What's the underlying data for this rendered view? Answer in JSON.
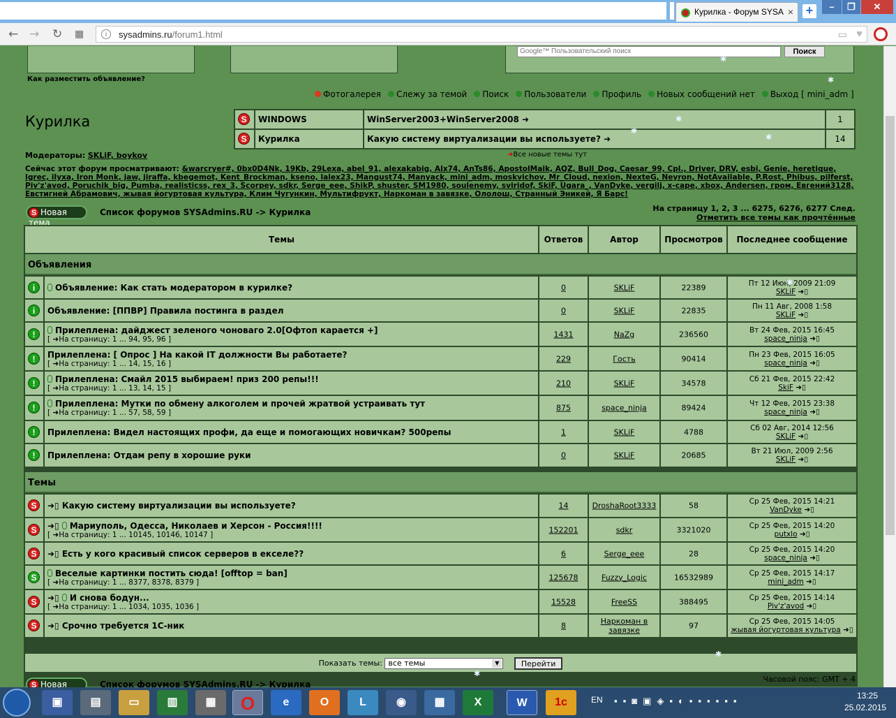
{
  "browser": {
    "tab_title": "Курилка - Форум SYSA",
    "tab_close": "×",
    "new_tab": "+",
    "url_host": "sysadmins.ru",
    "url_path": "/forum1.html",
    "win_min": "–",
    "win_max": "❐",
    "win_close": "✕"
  },
  "top": {
    "how_to_ad": "Как разместить объявление?",
    "google_placeholder": "Google™ Пользовательский поиск",
    "search_button": "Поиск"
  },
  "navlinks": [
    {
      "label": "Фотогалерея",
      "color": "#d83a1a"
    },
    {
      "label": "Слежу за темой",
      "color": "#2a8a2a"
    },
    {
      "label": "Поиск",
      "color": "#2a8a2a"
    },
    {
      "label": "Пользователи",
      "color": "#2a8a2a"
    },
    {
      "label": "Профиль",
      "color": "#2a8a2a"
    },
    {
      "label": "Новых сообщений нет",
      "color": "#2a8a2a"
    },
    {
      "label": "Выход [ mini_adm ]",
      "color": "#2a8a2a"
    }
  ],
  "forum_title": "Курилка",
  "new_topics": [
    {
      "forum": "WINDOWS",
      "topic": "WinServer2003+WinServer2008 ➜",
      "count": "1"
    },
    {
      "forum": "Курилка",
      "topic": "Какую систему виртуализации вы используете? ➜",
      "count": "14"
    }
  ],
  "all_new_link": "Все новые темы тут",
  "moderators": {
    "label": "Модераторы:",
    "names": "SKLiF, boykov"
  },
  "viewers": {
    "label": "Сейчас этот форум просматривают:",
    "names": "&warcryer#, 0bx0D4Nk, 19Kb, 29Lexa, abel_91, alexakabig, Alx74, AnTs86, ApostolMaik, AQZ, Bull_Dog, Caesar_99, Cpl., Driver, DRV, esbi, Genie, heretique, Igrec, ilyxa, Iron Monk, jaw, jiraffa, kbegemot, Kent_Brockman, kseno, lalex23, Mangust74, Manyack, mini_adm, moskvichov, Mr_Cloud, nexion, NexteG, Neyron, NotAvailable, P.Rost, Phibus, pilferst, Piv'z'avod, Poruchik_big, Pumba, realisticss, rex_3, Scorpey, sdkr, Serge_eee, ShikP, shuster, SM1980, soulenemy, sviridof, SkiF, Ugara_, VanDyke, vergilj, x-cape, xbox, Andersen, гром, Евгений3128, Евстигней Абрамович, жывая йогуртовая культура, Клим Чугункин, Мультифрукт, Наркоман в завязке, Ололош, Странный Эникей, Я Барс!"
  },
  "new_topic_button": "Новая тема",
  "breadcrumb": "Список форумов SYSAdmins.RU -> Курилка",
  "pager": {
    "text": "На страницу 1, 2, 3 ... 6275, 6276, 6277  След.",
    "mark_read": "Отметить все темы как прочтённые"
  },
  "table_headers": {
    "topics": "Темы",
    "replies": "Ответов",
    "author": "Автор",
    "views": "Просмотров",
    "last": "Последнее сообщение"
  },
  "section_announce": "Объявления",
  "section_topics": "Темы",
  "announcements": [
    {
      "icon": "info",
      "clip": true,
      "title": "Объявление: Как стать модератором в курилке?",
      "pages": "",
      "replies": "0",
      "author": "SKLiF",
      "views": "22389",
      "last_date": "Пт 12 Июн, 2009 21:09",
      "last_user": "SKLiF"
    },
    {
      "icon": "info",
      "clip": false,
      "title": "Объявление: [ППВР] Правила постинга в раздел",
      "pages": "",
      "replies": "0",
      "author": "SKLiF",
      "views": "22835",
      "last_date": "Пн 11 Авг, 2008 1:58",
      "last_user": "SKLiF"
    },
    {
      "icon": "sticky",
      "clip": true,
      "title": "Прилеплена: дайджест зеленого чоноваго 2.0[Офтоп карается +]",
      "pages": "[ ➜На страницу: 1 ... 94, 95, 96 ]",
      "replies": "1431",
      "author": "NaZg",
      "views": "236560",
      "last_date": "Вт 24 Фев, 2015 16:45",
      "last_user": "space_ninja"
    },
    {
      "icon": "sticky",
      "clip": false,
      "title": "Прилеплена: [ Опрос ] На какой IT должности Вы работаете?",
      "pages": "[ ➜На страницу: 1 ... 14, 15, 16 ]",
      "replies": "229",
      "author": "Гость",
      "views": "90414",
      "last_date": "Пн 23 Фев, 2015 16:05",
      "last_user": "space_ninja"
    },
    {
      "icon": "sticky",
      "clip": true,
      "title": "Прилеплена: Смайл 2015 выбираем! приз 200 репы!!!",
      "pages": "[ ➜На страницу: 1 ... 13, 14, 15 ]",
      "replies": "210",
      "author": "SKLiF",
      "views": "34578",
      "last_date": "Сб 21 Фев, 2015 22:42",
      "last_user": "SkiF"
    },
    {
      "icon": "sticky",
      "clip": true,
      "title": "Прилеплена: Мутки по обмену алкоголем и прочей жратвой устраивать тут",
      "pages": "[ ➜На страницу: 1 ... 57, 58, 59 ]",
      "replies": "875",
      "author": "space_ninja",
      "views": "89424",
      "last_date": "Чт 12 Фев, 2015 23:38",
      "last_user": "space_ninja"
    },
    {
      "icon": "sticky",
      "clip": false,
      "title": "Прилеплена: Видел настоящих профи, да еще и помогающих новичкам? 500репы",
      "pages": "",
      "replies": "1",
      "author": "SKLiF",
      "views": "4788",
      "last_date": "Сб 02 Авг, 2014 12:56",
      "last_user": "SKLiF"
    },
    {
      "icon": "sticky",
      "clip": false,
      "title": "Прилеплена: Отдам репу в хорошие руки",
      "pages": "",
      "replies": "0",
      "author": "SKLiF",
      "views": "20685",
      "last_date": "Вт 21 Июл, 2009 2:56",
      "last_user": "SKLiF"
    }
  ],
  "topics": [
    {
      "icon": "red",
      "arrow": true,
      "clip": false,
      "title": "Какую систему виртуализации вы используете?",
      "pages": "",
      "replies": "14",
      "author": "DroshaRoot3333",
      "views": "58",
      "last_date": "Ср 25 Фев, 2015 14:21",
      "last_user": "VanDyke"
    },
    {
      "icon": "red",
      "arrow": true,
      "clip": true,
      "title": "Мариуполь, Одесса, Николаев и Херсон - Россия!!!!",
      "pages": "[ ➜На страницу: 1 ... 10145, 10146, 10147 ]",
      "replies": "152201",
      "author": "sdkr",
      "views": "3321020",
      "last_date": "Ср 25 Фев, 2015 14:20",
      "last_user": "putxlo"
    },
    {
      "icon": "red",
      "arrow": true,
      "clip": false,
      "title": "Есть у кого красивый список серверов в екселе??",
      "pages": "",
      "replies": "6",
      "author": "Serge_eee",
      "views": "28",
      "last_date": "Ср 25 Фев, 2015 14:20",
      "last_user": "space_ninja"
    },
    {
      "icon": "green",
      "arrow": false,
      "clip": true,
      "title": "Веселые картинки постить сюда! [offtop = ban]",
      "pages": "[ ➜На страницу: 1 ... 8377, 8378, 8379 ]",
      "replies": "125678",
      "author": "Fuzzy_Logic",
      "views": "16532989",
      "last_date": "Ср 25 Фев, 2015 14:17",
      "last_user": "mini_adm"
    },
    {
      "icon": "red",
      "arrow": true,
      "clip": true,
      "title": "И снова бодун...",
      "pages": "[ ➜На страницу: 1 ... 1034, 1035, 1036 ]",
      "replies": "15528",
      "author": "FreeSS",
      "views": "388495",
      "last_date": "Ср 25 Фев, 2015 14:14",
      "last_user": "Piv'z'avod"
    },
    {
      "icon": "red",
      "arrow": true,
      "clip": false,
      "title": "Срочно требуется 1С-ник",
      "pages": "",
      "replies": "8",
      "author": "Наркоман в завязке",
      "views": "97",
      "last_date": "Ср 25 Фев, 2015 14:05",
      "last_user": "жывая йогуртовая культура"
    }
  ],
  "footer": {
    "show_label": "Показать темы:",
    "select_value": "все темы",
    "go_button": "Перейти"
  },
  "bottom": {
    "new_topic": "Новая тема",
    "breadcrumb": "Список форумов SYSAdmins.RU -> Курилка",
    "timezone": "Часовой пояс: GMT + 4"
  },
  "taskbar": {
    "lang": "EN",
    "time": "13:25",
    "date": "25.02.2015"
  }
}
